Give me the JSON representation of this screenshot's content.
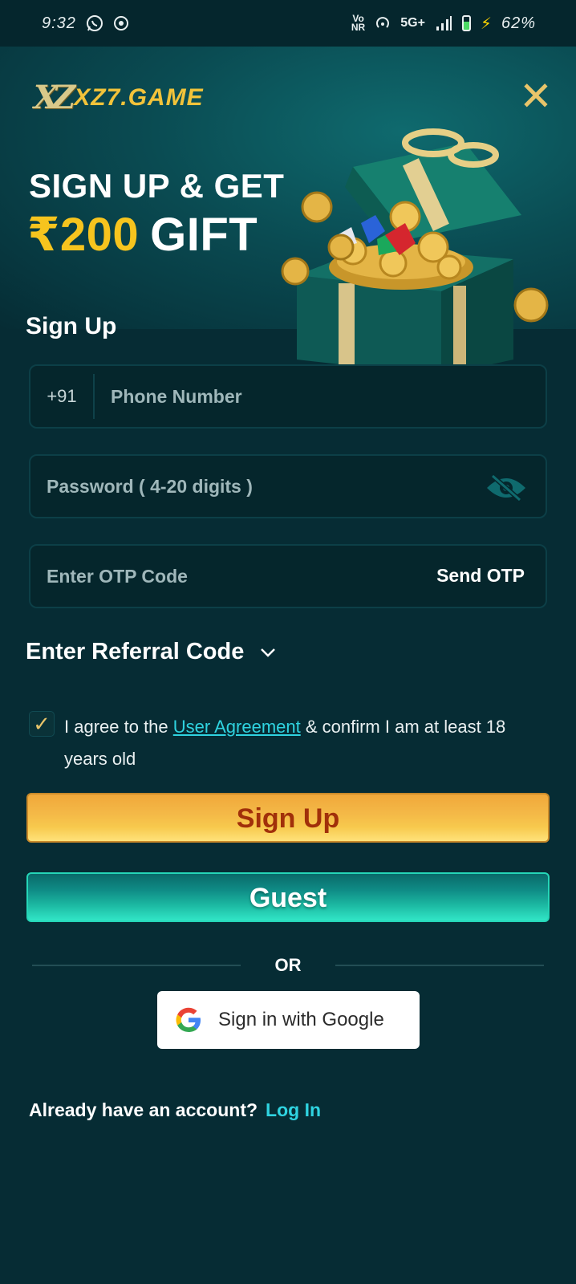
{
  "status_bar": {
    "time": "9:32",
    "network_badge_top": "Vo",
    "network_badge_bottom": "NR",
    "network_type": "5G+",
    "battery_percent": "62%",
    "battery_level": 0.62
  },
  "header": {
    "logo_text": "XZ7.GAME",
    "logo_mark": "XZ",
    "close_icon": "close-icon"
  },
  "hero": {
    "line1": "SIGN UP & GET",
    "amount": "₹200",
    "gift": "GIFT"
  },
  "form": {
    "title": "Sign Up",
    "country_code": "+91",
    "phone_placeholder": "Phone Number",
    "password_placeholder": "Password ( 4-20 digits )",
    "otp_placeholder": "Enter OTP Code",
    "send_otp_label": "Send OTP",
    "referral_label": "Enter Referral Code",
    "agree_prefix": "I agree to the ",
    "agree_link": "User Agreement",
    "agree_suffix": " & confirm I am at least 18 years old",
    "agree_checked": true,
    "signup_button": "Sign Up",
    "guest_button": "Guest",
    "or_text": "OR",
    "google_button": "Sign in with Google",
    "login_prompt": "Already have an account?",
    "login_link": "Log In"
  },
  "colors": {
    "background": "#062c34",
    "accent_gold": "#f6c41e",
    "link_cyan": "#2fd3e0",
    "signup_text": "#a1300a",
    "guest_green": "#1bb6a0"
  }
}
